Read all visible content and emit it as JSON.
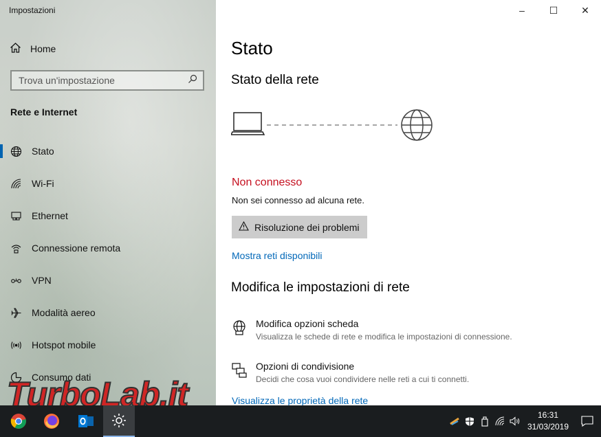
{
  "window": {
    "title": "Impostazioni",
    "controls": {
      "minimize": "–",
      "maximize": "☐",
      "close": "✕"
    }
  },
  "sidebar": {
    "home_label": "Home",
    "search_placeholder": "Trova un'impostazione",
    "section_title": "Rete e Internet",
    "items": [
      {
        "label": "Stato",
        "icon": "globe-icon",
        "active": true
      },
      {
        "label": "Wi-Fi",
        "icon": "wifi-icon"
      },
      {
        "label": "Ethernet",
        "icon": "ethernet-icon"
      },
      {
        "label": "Connessione remota",
        "icon": "dialup-icon"
      },
      {
        "label": "VPN",
        "icon": "vpn-icon"
      },
      {
        "label": "Modalità aereo",
        "icon": "airplane-icon"
      },
      {
        "label": "Hotspot mobile",
        "icon": "hotspot-icon"
      },
      {
        "label": "Consumo dati",
        "icon": "data-usage-icon"
      }
    ]
  },
  "main": {
    "title": "Stato",
    "network_status_heading": "Stato della rete",
    "status_label": "Non connesso",
    "status_text": "Non sei connesso ad alcuna rete.",
    "troubleshoot_label": "Risoluzione dei problemi",
    "show_networks_link": "Mostra reti disponibili",
    "change_settings_heading": "Modifica le impostazioni di rete",
    "options": [
      {
        "title": "Modifica opzioni scheda",
        "desc": "Visualizza le schede di rete e modifica le impostazioni di connessione.",
        "icon": "adapter-options-icon"
      },
      {
        "title": "Opzioni di condivisione",
        "desc": "Decidi che cosa vuoi condividere nelle reti a cui ti connetti.",
        "icon": "sharing-options-icon"
      }
    ],
    "properties_link": "Visualizza le proprietà della rete",
    "status_color": "#c50f1f",
    "link_color": "#0067b8"
  },
  "taskbar": {
    "apps": [
      "chrome-icon",
      "firefox-icon",
      "outlook-icon",
      "settings-icon"
    ],
    "clock_time": "16:31",
    "clock_date": "31/03/2019"
  },
  "watermark": "TurboLab.it"
}
